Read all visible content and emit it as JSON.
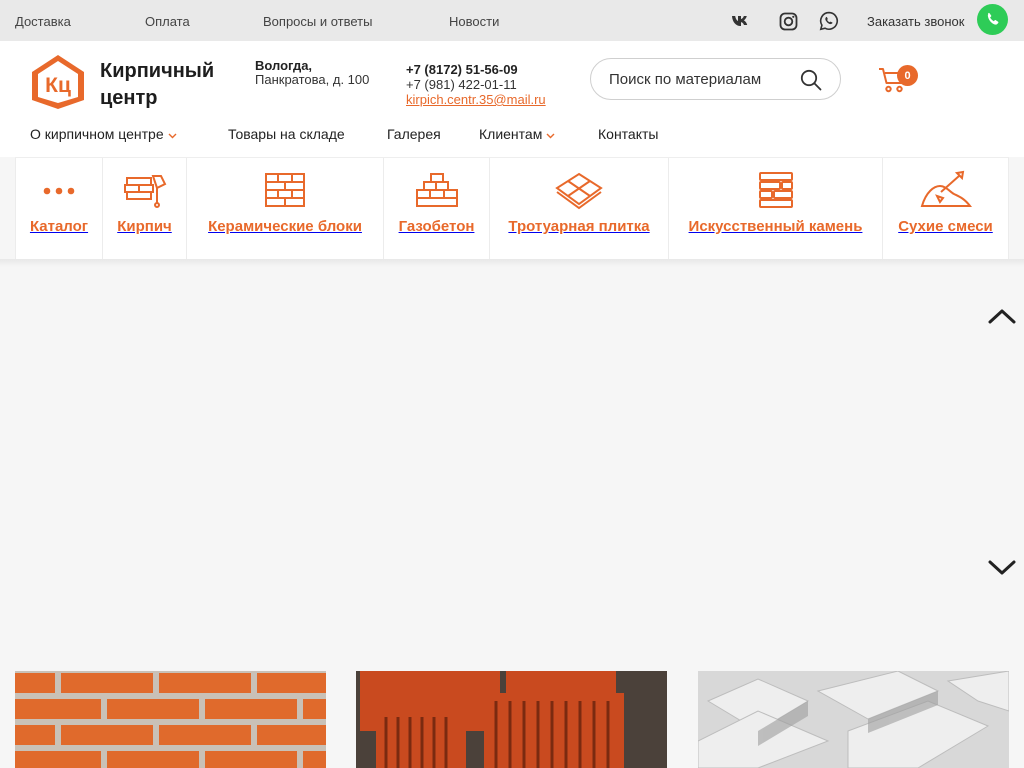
{
  "topbar": {
    "links": [
      "Доставка",
      "Оплата",
      "Вопросы и ответы",
      "Новости"
    ],
    "social": [
      "vk-icon",
      "instagram-icon",
      "whatsapp-icon"
    ],
    "callback_label": "Заказать звонок"
  },
  "header": {
    "logo_text": "Кирпичный центр",
    "logo_letters": "Кц",
    "address_city": "Вологда,",
    "address_street": "Панкратова, д. 100",
    "phone1": "+7 (8172) 51-56-09",
    "phone2": "+7 (981) 422-01-11",
    "email": "kirpich.centr.35@mail.ru",
    "search_placeholder": "Поиск по материалам",
    "cart_count": "0"
  },
  "main_nav": [
    {
      "label": "О кирпичном центре",
      "has_dropdown": true
    },
    {
      "label": "Товары на складе",
      "has_dropdown": false
    },
    {
      "label": "Галерея",
      "has_dropdown": false
    },
    {
      "label": "Клиентам",
      "has_dropdown": true
    },
    {
      "label": "Контакты",
      "has_dropdown": false
    }
  ],
  "categories": [
    {
      "label": "Каталог",
      "icon": "dots-icon"
    },
    {
      "label": "Кирпич",
      "icon": "brick-trowel-icon"
    },
    {
      "label": "Керамические блоки",
      "icon": "ceramic-blocks-icon"
    },
    {
      "label": "Газобетон",
      "icon": "gas-concrete-icon"
    },
    {
      "label": "Тротуарная плитка",
      "icon": "paving-tile-icon"
    },
    {
      "label": "Искусственный камень",
      "icon": "artificial-stone-icon"
    },
    {
      "label": "Сухие смеси",
      "icon": "dry-mix-icon"
    }
  ],
  "colors": {
    "accent": "#e8692b",
    "call_button": "#2ecc57",
    "topbar_bg": "#e9e9e9"
  },
  "cards": [
    "brick-wall-image",
    "ceramic-blocks-image",
    "gas-concrete-image"
  ]
}
